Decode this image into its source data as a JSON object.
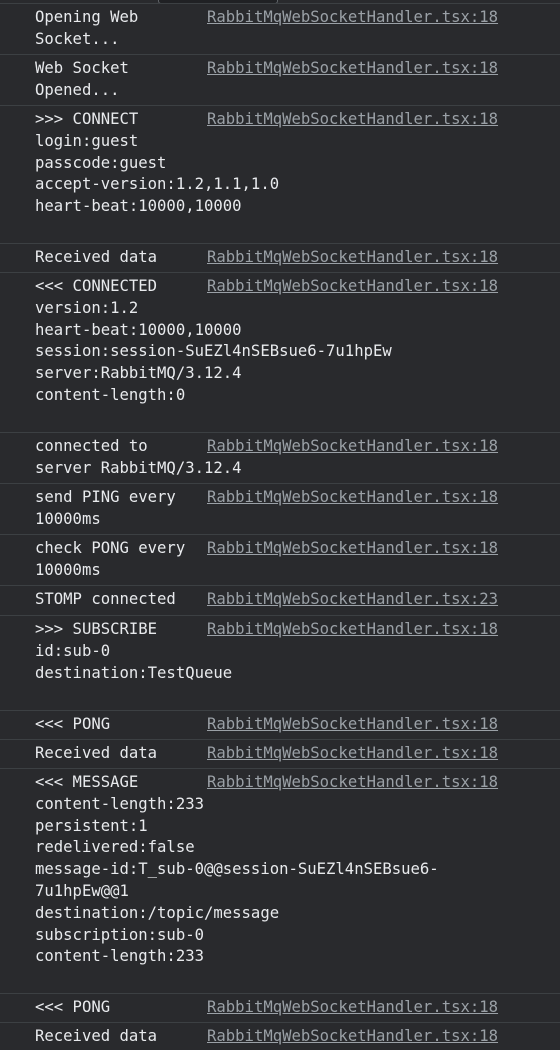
{
  "console": {
    "entries": [
      {
        "message": "Opening Web\nSocket...",
        "source": "RabbitMqWebSocketHandler.tsx:18"
      },
      {
        "message": "Web Socket\nOpened...",
        "source": "RabbitMqWebSocketHandler.tsx:18"
      },
      {
        "message": ">>> CONNECT\nlogin:guest\npasscode:guest\naccept-version:1.2,1.1,1.0\nheart-beat:10000,10000",
        "source": "RabbitMqWebSocketHandler.tsx:18"
      },
      {
        "message": "Received data",
        "source": "RabbitMqWebSocketHandler.tsx:18"
      },
      {
        "message": "<<< CONNECTED\nversion:1.2\nheart-beat:10000,10000\nsession:session-SuEZl4nSEBsue6-7u1hpEw\nserver:RabbitMQ/3.12.4\ncontent-length:0",
        "source": "RabbitMqWebSocketHandler.tsx:18"
      },
      {
        "message": "connected to\nserver RabbitMQ/3.12.4",
        "source": "RabbitMqWebSocketHandler.tsx:18"
      },
      {
        "message": "send PING every\n10000ms",
        "source": "RabbitMqWebSocketHandler.tsx:18"
      },
      {
        "message": "check PONG every\n10000ms",
        "source": "RabbitMqWebSocketHandler.tsx:18"
      },
      {
        "message": "STOMP connected",
        "source": "RabbitMqWebSocketHandler.tsx:23"
      },
      {
        "message": ">>> SUBSCRIBE\nid:sub-0\ndestination:TestQueue",
        "source": "RabbitMqWebSocketHandler.tsx:18"
      },
      {
        "message": "<<< PONG",
        "source": "RabbitMqWebSocketHandler.tsx:18"
      },
      {
        "message": "Received data",
        "source": "RabbitMqWebSocketHandler.tsx:18"
      },
      {
        "message": "<<< MESSAGE\ncontent-length:233\npersistent:1\nredelivered:false\nmessage-id:T_sub-0@@session-SuEZl4nSEBsue6-\n7u1hpEw@@1\ndestination:/topic/message\nsubscription:sub-0\ncontent-length:233",
        "source": "RabbitMqWebSocketHandler.tsx:18"
      },
      {
        "message": "<<< PONG",
        "source": "RabbitMqWebSocketHandler.tsx:18"
      },
      {
        "message": "Received data",
        "source": "RabbitMqWebSocketHandler.tsx:18"
      }
    ]
  },
  "colors": {
    "background": "#292a2d",
    "text": "#e8eaed",
    "link": "#9aa0a6",
    "divider": "#3c4043"
  }
}
